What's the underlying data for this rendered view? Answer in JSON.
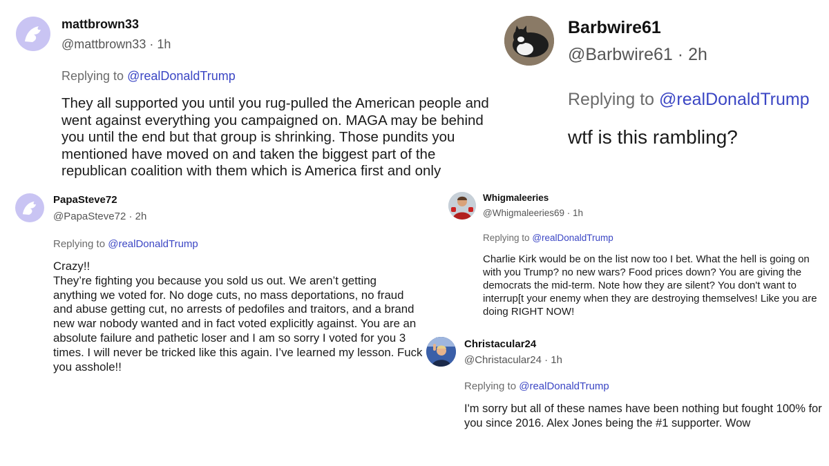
{
  "replying_prefix": "Replying to",
  "posts": [
    {
      "username": "mattbrown33",
      "handle": "@mattbrown33",
      "age": "1h",
      "mention": "@realDonaldTrump",
      "avatar": "eagle-default-avatar-icon",
      "text": [
        "They all supported you until you rug-pulled the American people and went against everything you campaigned on. MAGA may be behind you until the end but that group is shrinking. Those pundits you mentioned have moved on and taken the biggest part of the republican coalition with them which is America first and only"
      ]
    },
    {
      "username": "Barbwire61",
      "handle": "@Barbwire61",
      "age": "2h",
      "mention": "@realDonaldTrump",
      "avatar": "cat-photo-avatar",
      "text": [
        "wtf is this rambling?"
      ]
    },
    {
      "username": "PapaSteve72",
      "handle": "@PapaSteve72",
      "age": "2h",
      "mention": "@realDonaldTrump",
      "avatar": "eagle-default-avatar-icon",
      "text": [
        "Crazy!!",
        "They’re fighting you because you sold us out. We aren’t getting anything we voted for.  No doge cuts, no mass deportations, no fraud and abuse getting cut, no arrests of pedofiles and traitors, and a brand new war nobody wanted and in fact voted explicitly against. You are an absolute failure and pathetic loser and I am so sorry I voted for you 3 times. I will never be tricked like this again. I’ve learned my lesson.  Fuck you asshole!!"
      ]
    },
    {
      "username": "Whigmaleeries",
      "handle": "@Whigmaleeries69",
      "age": "1h",
      "mention": "@realDonaldTrump",
      "avatar": "man-photo-avatar",
      "text": [
        "Charlie Kirk would be on the list now too I bet. What the hell is going on with you Trump? no new wars? Food prices down? You are giving the democrats the mid-term. Note how they are silent? You don't want to interrup[t your enemy when they are destroying themselves! Like you are doing RIGHT NOW!"
      ]
    },
    {
      "username": "Christacular24",
      "handle": "@Christacular24",
      "age": "1h",
      "mention": "@realDonaldTrump",
      "avatar": "trump-photo-avatar",
      "text": [
        "I'm sorry but all of these names have been nothing but fought 100%  for you since 2016. Alex Jones being the #1 supporter. Wow"
      ]
    }
  ]
}
